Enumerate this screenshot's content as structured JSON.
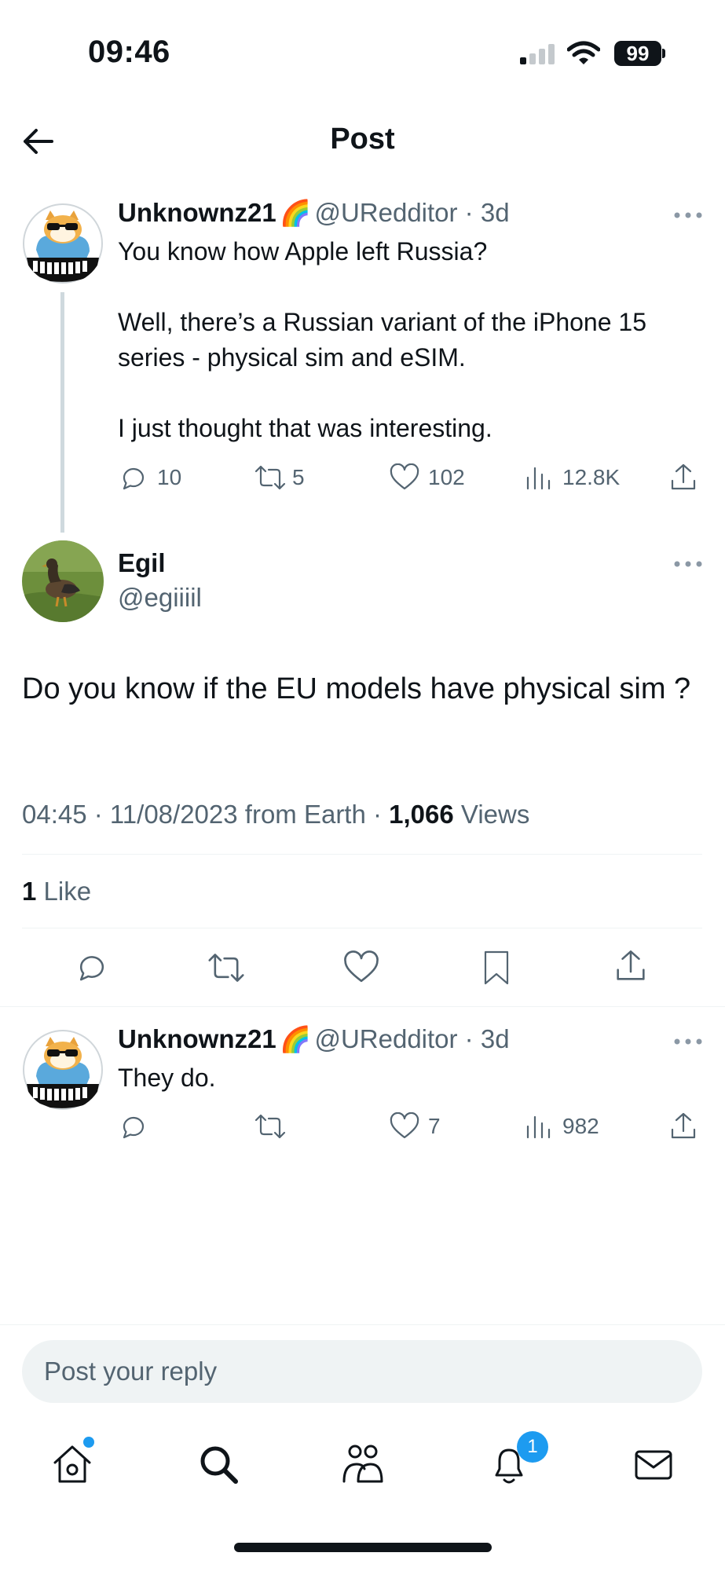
{
  "status_bar": {
    "time": "09:46",
    "battery": "99"
  },
  "header": {
    "title": "Post"
  },
  "parent_tweet": {
    "author_name": "Unknownz21",
    "author_emoji": "🌈",
    "handle_and_time": "@URedditor · 3d",
    "lines": [
      "You know how Apple left Russia?",
      "Well, there’s a Russian variant of the iPhone 15 series - physical sim and eSIM.",
      "I just thought that was interesting."
    ],
    "replies": "10",
    "reposts": "5",
    "likes": "102",
    "views": "12.8K"
  },
  "main_tweet": {
    "author_name": "Egil",
    "handle": "@egiiiil",
    "text": "Do you know if the EU models have physical sim ?",
    "timestamp": "04:45 · 11/08/2023 from Earth · ",
    "views_count": "1,066",
    "views_label": " Views",
    "likes_count": "1",
    "likes_label": " Like"
  },
  "reply_tweet": {
    "author_name": "Unknownz21",
    "author_emoji": "🌈",
    "handle_and_time": "@URedditor · 3d",
    "text": "They do.",
    "likes": "7",
    "views": "982"
  },
  "composer": {
    "placeholder": "Post your reply"
  },
  "tab_bar": {
    "items": [
      "home-icon",
      "search-icon",
      "communities-icon",
      "notifications-icon",
      "messages-icon"
    ],
    "notifications_badge": "1"
  },
  "colors": {
    "accent": "#1d9bf0",
    "text": "#0f1419",
    "muted": "#536471",
    "divider": "#eff3f4"
  }
}
